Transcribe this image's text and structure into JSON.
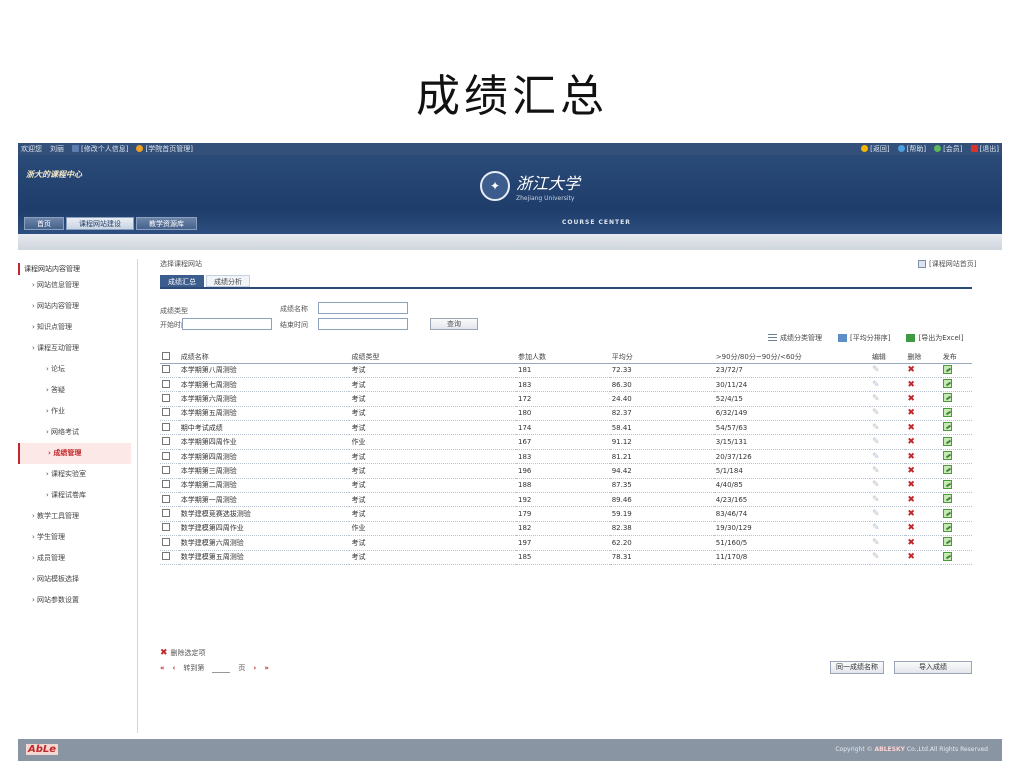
{
  "slide": {
    "title": "成绩汇总"
  },
  "topbar": {
    "left": [
      "欢迎您",
      "刘丽",
      "[修改个人信息]",
      "[学院首页管理]"
    ],
    "right": [
      "[返回]",
      "[帮助]",
      "[会员]",
      "[退出]"
    ]
  },
  "header": {
    "site_name": "浙大的课程中心",
    "logo_cn": "浙江大学",
    "logo_en": "Zhejiang University",
    "course_center": "COURSE CENTER",
    "nav": [
      "首页",
      "课程网站建设",
      "教学资源库"
    ]
  },
  "sidebar": {
    "items": [
      {
        "label": "课程网站内容管理",
        "level": "root"
      },
      {
        "label": "› 网站信息管理",
        "level": "item"
      },
      {
        "label": "› 网站内容管理",
        "level": "item"
      },
      {
        "label": "› 知识点管理",
        "level": "item"
      },
      {
        "label": "› 课程互动管理",
        "level": "item"
      },
      {
        "label": "› 论坛",
        "level": "sub"
      },
      {
        "label": "› 答疑",
        "level": "sub"
      },
      {
        "label": "› 作业",
        "level": "sub"
      },
      {
        "label": "› 网络考试",
        "level": "sub"
      },
      {
        "label": "› 成绩管理",
        "level": "sub",
        "active": true
      },
      {
        "label": "› 课程实验室",
        "level": "sub"
      },
      {
        "label": "› 课程试卷库",
        "level": "sub"
      },
      {
        "label": "› 教学工具管理",
        "level": "item"
      },
      {
        "label": "› 学生管理",
        "level": "item"
      },
      {
        "label": "› 成员管理",
        "level": "item"
      },
      {
        "label": "› 网站模板选择",
        "level": "item"
      },
      {
        "label": "› 网站参数设置",
        "level": "item"
      }
    ]
  },
  "main": {
    "breadcrumb": "选择课程网站",
    "teacher_link": "[课程网站首页]",
    "tabs": [
      "成绩汇总",
      "成绩分析"
    ],
    "filters": {
      "type_label": "成绩类型",
      "name_label": "成绩名称",
      "start_label": "开始时间",
      "end_label": "结束时间",
      "query": "查询"
    },
    "actions": [
      "成绩分类管理",
      "[平均分排序]",
      "[导出为Excel]"
    ],
    "columns": [
      "成绩名称",
      "成绩类型",
      "参加人数",
      "平均分",
      ">90分/80分~90分/<60分",
      "编辑",
      "删除",
      "发布"
    ],
    "rows": [
      [
        "本学期第八周测验",
        "考试",
        "181",
        "72.33",
        "23/72/7"
      ],
      [
        "本学期第七周测验",
        "考试",
        "183",
        "86.30",
        "30/11/24"
      ],
      [
        "本学期第六周测验",
        "考试",
        "172",
        "24.40",
        "52/4/15"
      ],
      [
        "本学期第五周测验",
        "考试",
        "180",
        "82.37",
        "6/32/149"
      ],
      [
        "期中考试成绩",
        "考试",
        "174",
        "58.41",
        "54/57/63"
      ],
      [
        "本学期第四周作业",
        "作业",
        "167",
        "91.12",
        "3/15/131"
      ],
      [
        "本学期第四周测验",
        "考试",
        "183",
        "81.21",
        "20/37/126"
      ],
      [
        "本学期第三周测验",
        "考试",
        "196",
        "94.42",
        "5/1/184"
      ],
      [
        "本学期第二周测验",
        "考试",
        "188",
        "87.35",
        "4/40/85"
      ],
      [
        "本学期第一周测验",
        "考试",
        "192",
        "89.46",
        "4/23/165"
      ],
      [
        "数学建模竞赛选拔测验",
        "考试",
        "179",
        "59.19",
        "83/46/74"
      ],
      [
        "数学建模第四周作业",
        "作业",
        "182",
        "82.38",
        "19/30/129"
      ],
      [
        "数学建模第六周测验",
        "考试",
        "197",
        "62.20",
        "51/160/5"
      ],
      [
        "数学建模第五周测验",
        "考试",
        "185",
        "78.31",
        "11/170/8"
      ]
    ],
    "delete_selected": "删除选定项",
    "pager": {
      "first": "«",
      "prev": "‹",
      "page_label": "转到第",
      "page_unit": "页",
      "next": "›",
      "last": "»"
    },
    "buttons": {
      "sync": "同一成绩名称",
      "import": "导入成绩"
    }
  },
  "footer": {
    "brand": "AbLe",
    "copyright_pre": "Copyright ©",
    "copyright_brand": "ABLESKY",
    "copyright_post": "Co.,Ltd.All Rights Reserved"
  },
  "colors": {
    "header": "#1f3d6b",
    "accent": "#c0282b",
    "footer": "#8a95a3"
  }
}
